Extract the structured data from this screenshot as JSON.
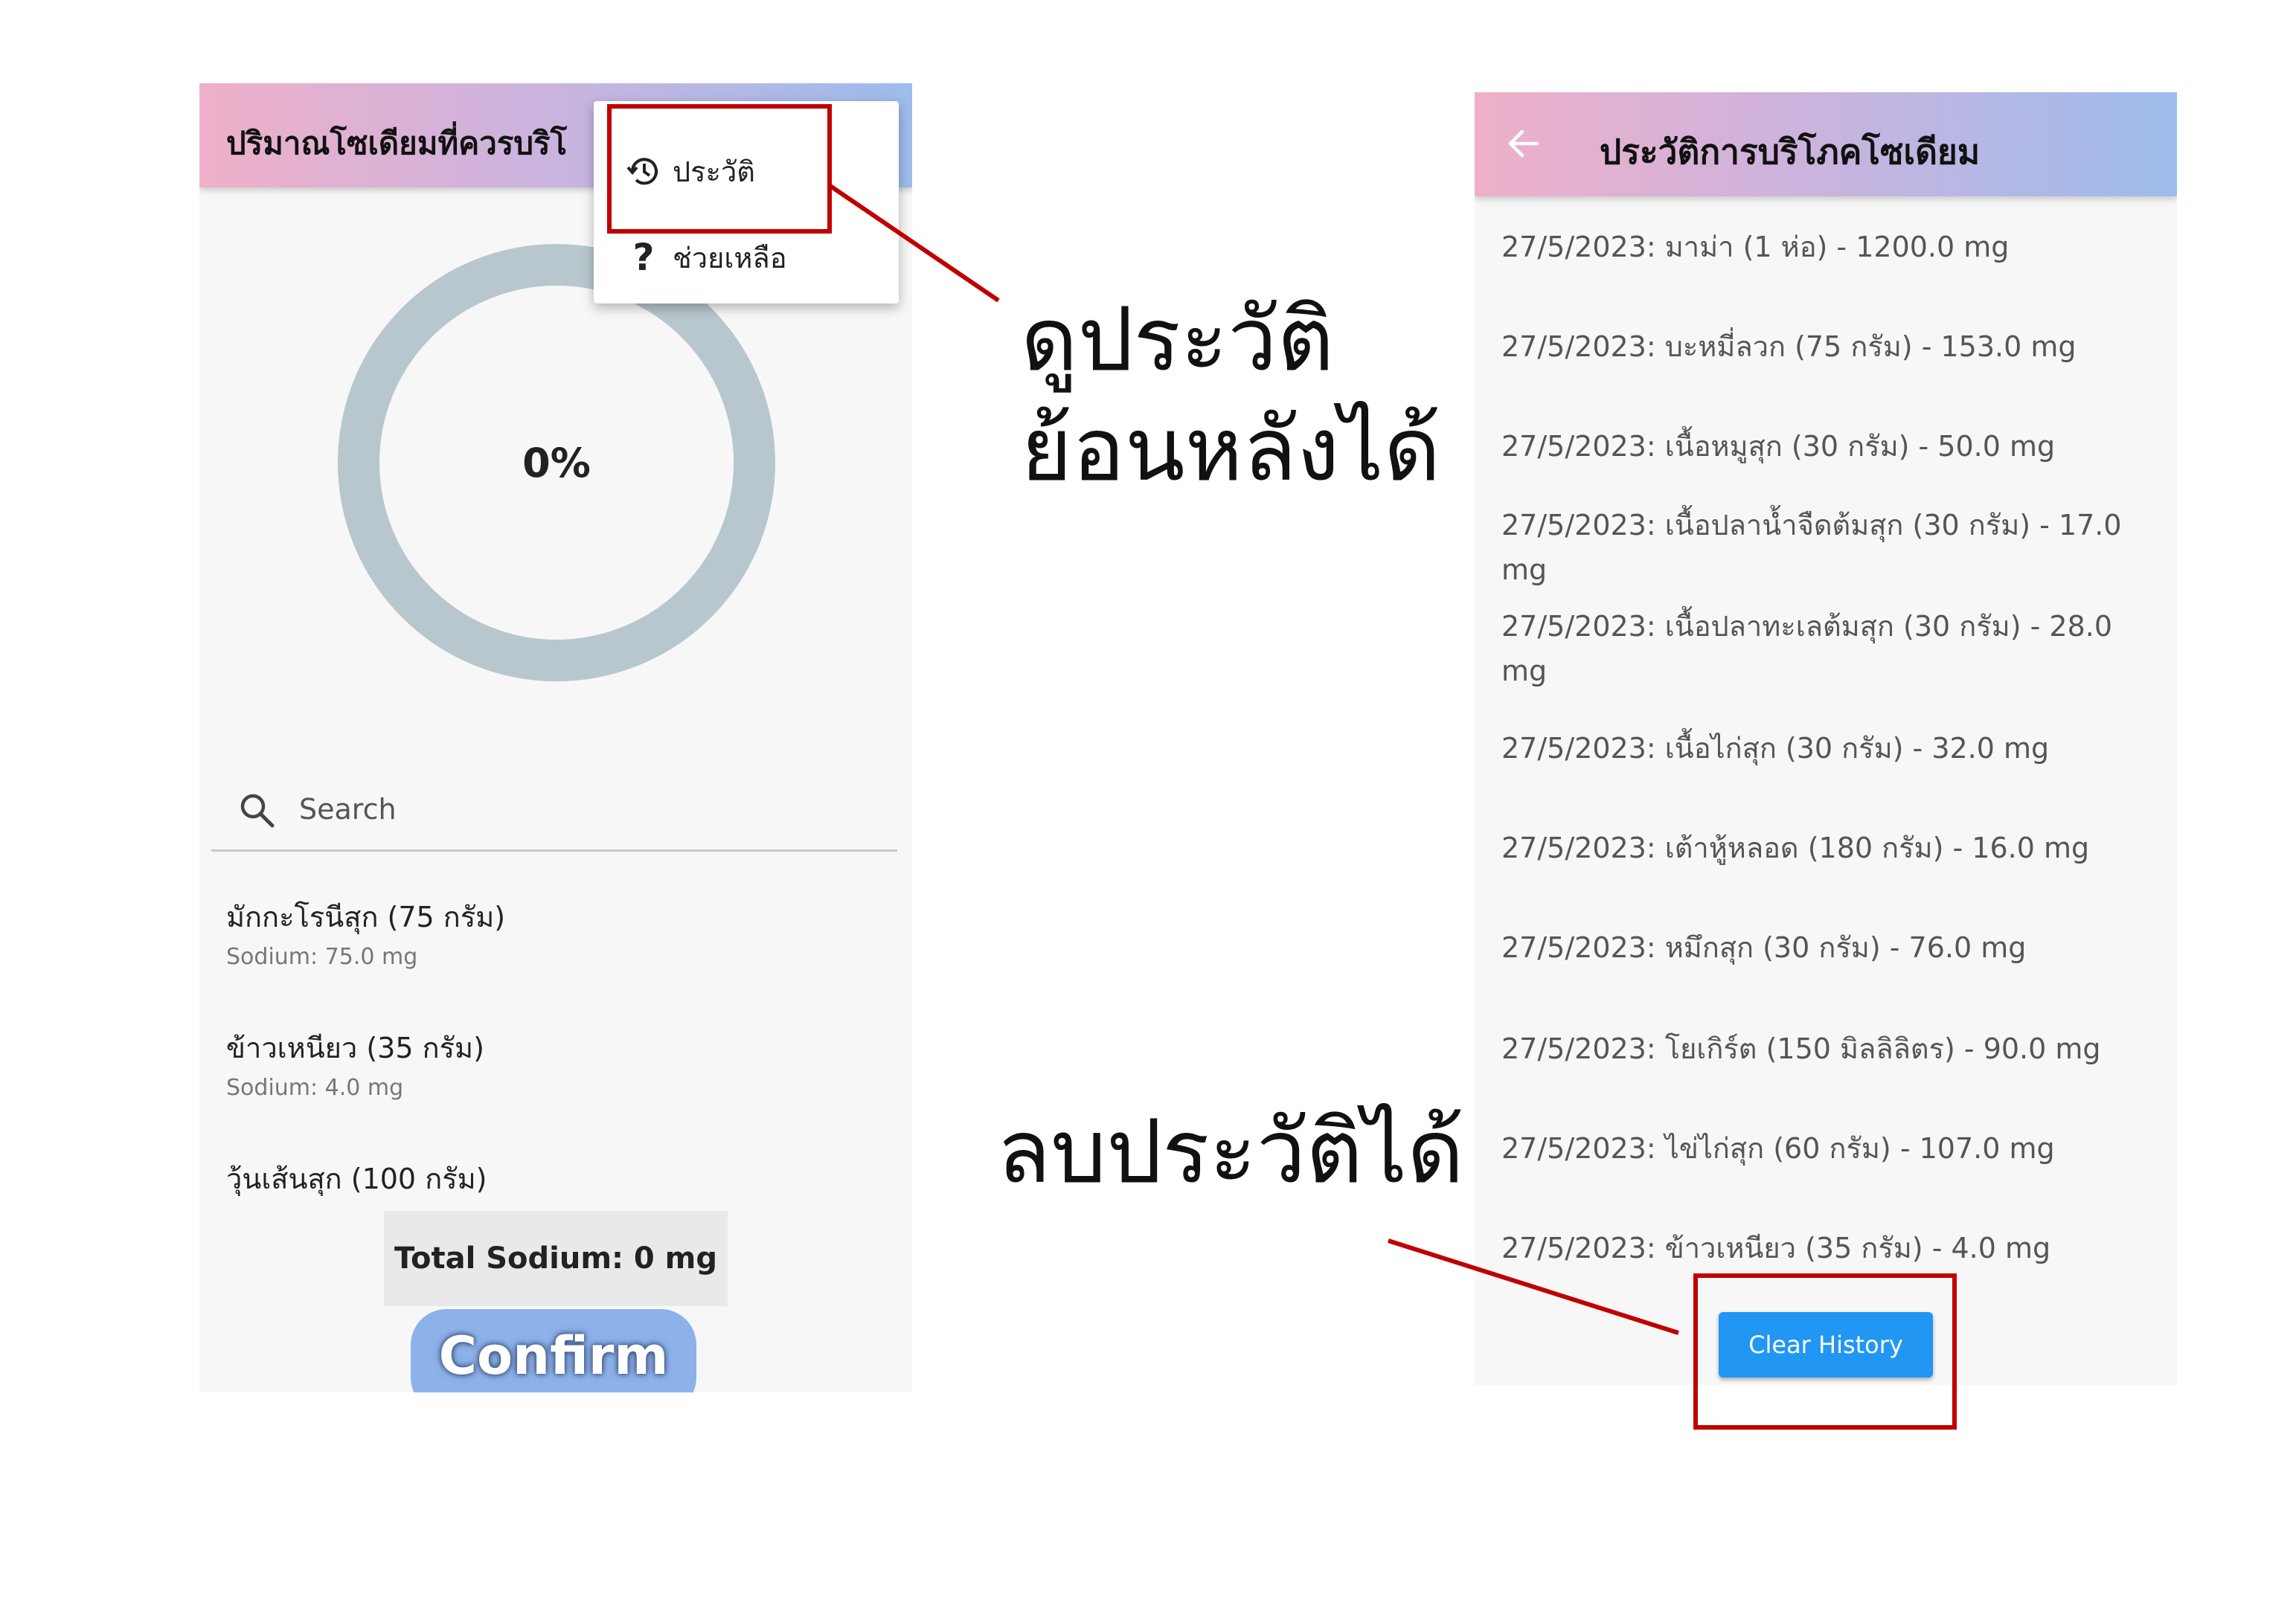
{
  "left_screen": {
    "title": "ปริมาณโซเดียมที่ควรบริโ",
    "progress_percent": 0,
    "progress_label": "0%",
    "menu": {
      "history_label": "ประวัติ",
      "help_label": "ช่วยเหลือ"
    },
    "search": {
      "placeholder": "Search"
    },
    "foods": [
      {
        "name": "มักกะโรนีสุก (75 กรัม)",
        "sodium": "Sodium: 75.0 mg"
      },
      {
        "name": "ข้าวเหนียว (35 กรัม)",
        "sodium": "Sodium: 4.0 mg"
      },
      {
        "name": "วุ้นเส้นสุก (100 กรัม)",
        "sodium": ""
      }
    ],
    "total_label": "Total Sodium: 0 mg",
    "confirm_label": "Confirm"
  },
  "right_screen": {
    "title": "ประวัติการบริโภคโซเดียม",
    "history": [
      "27/5/2023: มาม่า (1 ห่อ) - 1200.0 mg",
      "27/5/2023: บะหมี่ลวก (75 กรัม) - 153.0 mg",
      "27/5/2023: เนื้อหมูสุก (30 กรัม) - 50.0 mg",
      "27/5/2023: เนื้อปลาน้ำจืดต้มสุก (30 กรัม) - 17.0 mg",
      "27/5/2023: เนื้อปลาทะเลต้มสุก (30 กรัม) - 28.0 mg",
      "27/5/2023: เนื้อไก่สุก (30 กรัม) - 32.0 mg",
      "27/5/2023: เต้าหู้หลอด (180 กรัม) - 16.0 mg",
      "27/5/2023: หมึกสุก (30 กรัม) - 76.0 mg",
      "27/5/2023: โยเกิร์ต (150 มิลลิลิตร) - 90.0 mg",
      "27/5/2023: ไข่ไก่สุก (60 กรัม) - 107.0 mg",
      "27/5/2023: ข้าวเหนียว (35 กรัม) - 4.0 mg"
    ],
    "clear_label": "Clear History"
  },
  "annotations": {
    "view_history_line1": "ดูประวัติ",
    "view_history_line2": "ย้อนหลังได้",
    "delete_history": "ลบประวัติได้"
  },
  "colors": {
    "callout": "#c00000",
    "ring": "#b7c7cd",
    "clear_button": "#2196f3",
    "confirm_button": "#8db2ea"
  },
  "icons": [
    "history-icon",
    "help-icon",
    "back-arrow-icon",
    "search-icon"
  ]
}
